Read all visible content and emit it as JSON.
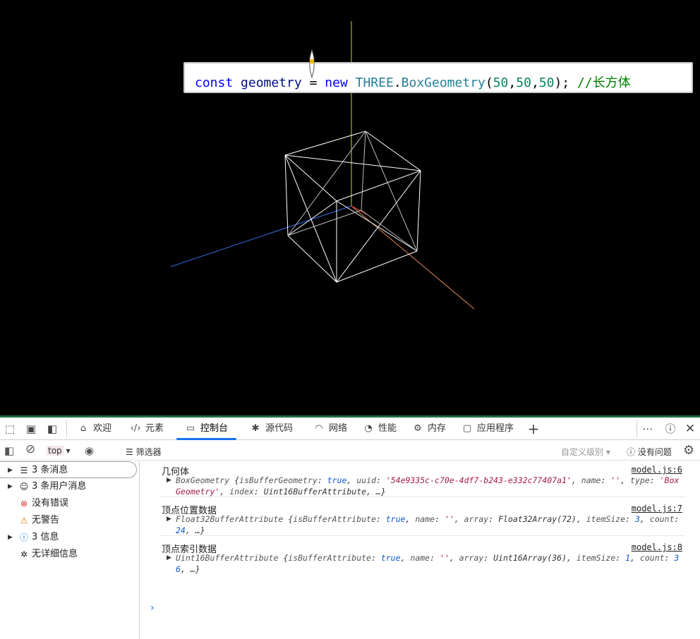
{
  "code_tip": {
    "kw_const": "const",
    "var_name": "geometry",
    "op": "=",
    "kw_new": "new",
    "cls_ns": "THREE",
    "dot": ".",
    "cls_name": "BoxGeometry",
    "paren_open": "(",
    "num1": "50",
    "num2": "50",
    "num3": "50",
    "comma": ",",
    "paren_close": ");",
    "comment_slashes": "//",
    "comment_text": "长方体"
  },
  "scene_colors": {
    "background": "#000000",
    "wireframe": "#ffffff",
    "axis_x": "#e08a50",
    "axis_y": "#b8d840",
    "axis_z": "#3a6ee8"
  },
  "tabs": [
    {
      "label": "欢迎",
      "icon": "home-icon"
    },
    {
      "label": "元素",
      "icon": "code-icon"
    },
    {
      "label": "控制台",
      "icon": "console-icon",
      "active": true
    },
    {
      "label": "源代码",
      "icon": "bug-icon"
    },
    {
      "label": "网络",
      "icon": "wifi-icon"
    },
    {
      "label": "性能",
      "icon": "gauge-icon"
    },
    {
      "label": "内存",
      "icon": "chip-icon"
    },
    {
      "label": "应用程序",
      "icon": "app-icon"
    }
  ],
  "toolbar": {
    "context": "top",
    "filter_label": "筛选器",
    "level_label": "自定义级别",
    "issues_label": "没有问题"
  },
  "sidebar": [
    {
      "label": "3 条消息",
      "icon": "list-icon",
      "expandable": true
    },
    {
      "label": "3 条用户消息",
      "icon": "user-icon",
      "expandable": true
    },
    {
      "label": "没有错误",
      "icon": "error-icon",
      "expandable": false
    },
    {
      "label": "无警告",
      "icon": "warning-icon",
      "expandable": false
    },
    {
      "label": "3 信息",
      "icon": "info-icon",
      "expandable": true
    },
    {
      "label": "无详细信息",
      "icon": "verbose-icon",
      "expandable": false
    }
  ],
  "messages": [
    {
      "title": "几何体",
      "source": "model.js:6",
      "obj": {
        "cls": "BoxGeometry",
        "k1": "isBufferGeometry",
        "v1": "true",
        "k2": "uuid",
        "v2": "'54e9335c-c70e-4df7-b243-e332c77407a1'",
        "k3": "name",
        "v3": "''",
        "k4": "type",
        "v4": "'BoxGeometry'",
        "k5": "index",
        "v5": "Uint16BufferAttribute",
        "tail": "…}"
      }
    },
    {
      "title": "顶点位置数据",
      "source": "model.js:7",
      "obj": {
        "cls": "Float32BufferAttribute",
        "k1": "isBufferAttribute",
        "v1": "true",
        "k2": "name",
        "v2": "''",
        "k3": "array",
        "v3": "Float32Array(72)",
        "k4": "itemSize",
        "v4": "3",
        "k5": "count",
        "v5": "24",
        "tail": "…}"
      }
    },
    {
      "title": "顶点索引数据",
      "source": "model.js:8",
      "obj": {
        "cls": "Uint16BufferAttribute",
        "k1": "isBufferAttribute",
        "v1": "true",
        "k2": "name",
        "v2": "''",
        "k3": "array",
        "v3": "Uint16Array(36)",
        "k4": "itemSize",
        "v4": "1",
        "k5": "count",
        "v5": "36",
        "tail": "…}"
      }
    }
  ]
}
